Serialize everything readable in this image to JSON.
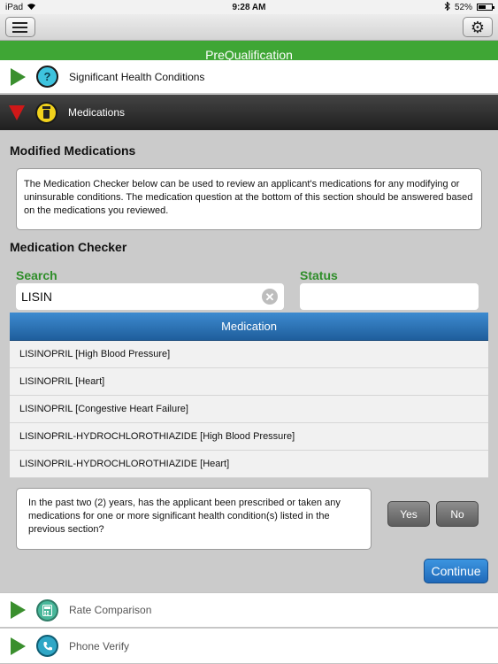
{
  "status_bar": {
    "carrier": "iPad",
    "time": "9:28 AM",
    "battery": "52%"
  },
  "toolbar": {
    "menu_icon": "list-icon",
    "settings_icon": "gear-icon"
  },
  "header": {
    "title": "PreQualification"
  },
  "sections": {
    "significant_health": {
      "label": "Significant Health Conditions",
      "icon_text": "?"
    },
    "medications": {
      "label": "Medications"
    },
    "rate_comparison": {
      "label": "Rate Comparison"
    },
    "phone_verify": {
      "label": "Phone Verify"
    }
  },
  "main": {
    "modified_title": "Modified Medications",
    "info_text": "The Medication Checker below can be used to review an applicant's medications for any modifying or uninsurable conditions. The medication question at the bottom of this section should be answered based on the medications you reviewed.",
    "checker_title": "Medication Checker",
    "search_label": "Search",
    "search_value": "LISIN",
    "status_label": "Status",
    "clear_glyph": "✕",
    "table_header": "Medication",
    "medications": [
      "LISINOPRIL  [High Blood Pressure]",
      "LISINOPRIL  [Heart]",
      "LISINOPRIL  [Congestive Heart Failure]",
      "LISINOPRIL-HYDROCHLOROTHIAZIDE  [High Blood Pressure]",
      "LISINOPRIL-HYDROCHLOROTHIAZIDE  [Heart]"
    ],
    "question": "In the past two (2) years, has the applicant been prescribed or taken any medications for one or more significant health condition(s) listed in the previous section?",
    "yes_label": "Yes",
    "no_label": "No",
    "continue_label": "Continue"
  },
  "colors": {
    "accent_green": "#3fa635",
    "header_blue": "#2a72b5",
    "continue_blue": "#2a7fd0"
  }
}
